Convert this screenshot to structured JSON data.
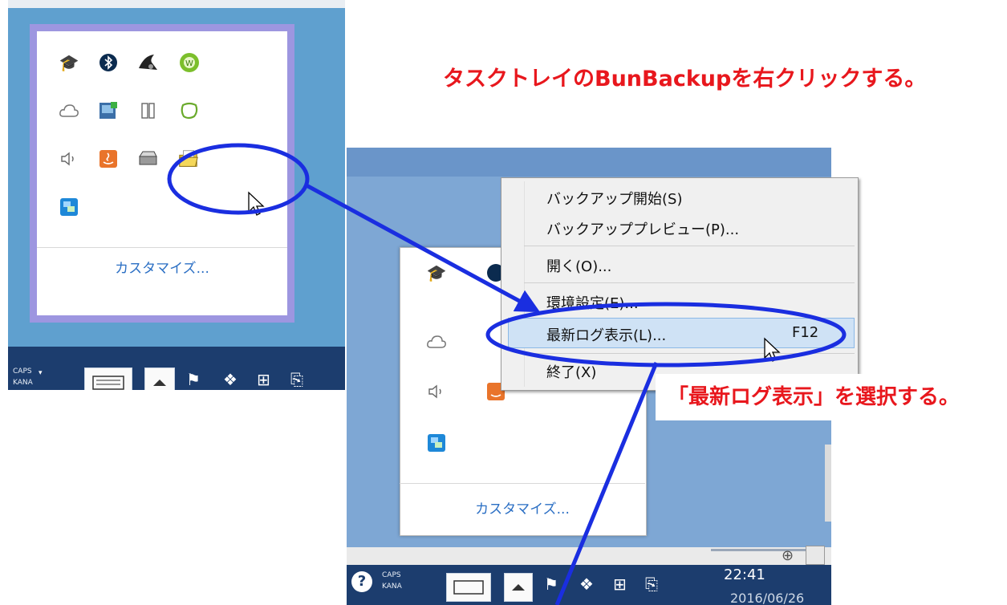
{
  "captions": {
    "step1": "タスクトレイのBunBackupを右クリックする。",
    "step2": "「最新ログ表示」を選択する。"
  },
  "panel1": {
    "tray_icons": [
      "graduation-cap-check-icon",
      "bluetooth-icon",
      "shark-icon",
      "green-w-icon",
      "cloud-icon",
      "photo-app-icon",
      "phone-network-icon",
      "green-leaf-icon",
      "speaker-icon",
      "java-icon",
      "drive-icon",
      "bunbackup-folder-icon",
      "network-app-icon"
    ],
    "customize_label": "カスタマイズ...",
    "caps_label": "CAPS",
    "kana_label": "KANA"
  },
  "panel2": {
    "context_menu": {
      "items": [
        {
          "label": "バックアップ開始(S)",
          "shortcut": ""
        },
        {
          "label": "バックアッププレビュー(P)...",
          "shortcut": ""
        },
        {
          "label": "開く(O)...",
          "shortcut": ""
        },
        {
          "label": "環境設定(E)...",
          "shortcut": ""
        },
        {
          "label": "最新ログ表示(L)...",
          "shortcut": "F12"
        },
        {
          "label": "終了(X)",
          "shortcut": ""
        }
      ],
      "highlighted_index": 4
    },
    "customize_label": "カスタマイズ...",
    "caps_label": "CAPS",
    "kana_label": "KANA",
    "clock": "22:41",
    "date_partial": "2016/06/26"
  },
  "colors": {
    "caption_red": "#e8171d",
    "annotation_blue": "#1a2ee0",
    "desktop_blue": "#5fa0cf",
    "taskbar": "#1c3d6e",
    "tray_border": "#9d96e0",
    "link_blue": "#2b6fc4",
    "menu_highlight": "#cfe2f5"
  }
}
